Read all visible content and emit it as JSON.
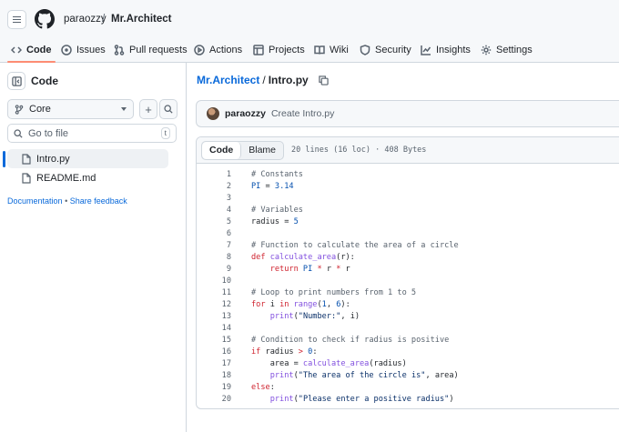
{
  "header": {
    "owner": "paraozzy",
    "separator": "/",
    "repo": "Mr.Architect"
  },
  "tabs": [
    {
      "label": "Code",
      "icon": "code-icon",
      "active": true
    },
    {
      "label": "Issues",
      "icon": "issue-opened-icon"
    },
    {
      "label": "Pull requests",
      "icon": "git-pull-request-icon"
    },
    {
      "label": "Actions",
      "icon": "play-icon"
    },
    {
      "label": "Projects",
      "icon": "table-icon"
    },
    {
      "label": "Wiki",
      "icon": "book-icon"
    },
    {
      "label": "Security",
      "icon": "shield-icon"
    },
    {
      "label": "Insights",
      "icon": "graph-icon"
    },
    {
      "label": "Settings",
      "icon": "gear-icon"
    }
  ],
  "sidebar": {
    "title": "Code",
    "branch": "Core",
    "search_placeholder": "Go to file",
    "search_shortcut": "t",
    "files": [
      {
        "name": "Intro.py",
        "selected": true
      },
      {
        "name": "README.md",
        "selected": false
      }
    ],
    "documentation": "Documentation",
    "link_sep": "•",
    "feedback": "Share feedback"
  },
  "breadcrumb": {
    "repo": "Mr.Architect",
    "sep": "/",
    "file": "Intro.py"
  },
  "commit": {
    "user": "paraozzy",
    "message": "Create Intro.py"
  },
  "code_view": {
    "tab_code": "Code",
    "tab_blame": "Blame",
    "meta": "20 lines (16 loc) · 408 Bytes"
  },
  "colors": {
    "accent": "#0969da",
    "tab_underline": "#fd8c73",
    "keyword": "#cf222e",
    "function": "#8250df",
    "number": "#0550ae",
    "string": "#0a3069",
    "comment": "#59636e"
  },
  "code_lines": [
    [
      [
        "cm",
        "# Constants"
      ]
    ],
    [
      [
        "cn",
        "PI"
      ],
      [
        "",
        " = "
      ],
      [
        "nu",
        "3.14"
      ]
    ],
    [],
    [
      [
        "cm",
        "# Variables"
      ]
    ],
    [
      [
        "",
        "radius = "
      ],
      [
        "nu",
        "5"
      ]
    ],
    [],
    [
      [
        "cm",
        "# Function to calculate the area of a circle"
      ]
    ],
    [
      [
        "kw",
        "def "
      ],
      [
        "fn",
        "calculate_area"
      ],
      [
        "",
        "(r):"
      ]
    ],
    [
      [
        "",
        "    "
      ],
      [
        "kw",
        "return "
      ],
      [
        "cn",
        "PI"
      ],
      [
        "",
        " "
      ],
      [
        "kw",
        "*"
      ],
      [
        "",
        " r "
      ],
      [
        "kw",
        "*"
      ],
      [
        "",
        " r"
      ]
    ],
    [],
    [
      [
        "cm",
        "# Loop to print numbers from 1 to 5"
      ]
    ],
    [
      [
        "kw",
        "for "
      ],
      [
        "",
        "i "
      ],
      [
        "kw",
        "in "
      ],
      [
        "fn",
        "range"
      ],
      [
        "",
        "("
      ],
      [
        "nu",
        "1"
      ],
      [
        "",
        ", "
      ],
      [
        "nu",
        "6"
      ],
      [
        "",
        "):"
      ]
    ],
    [
      [
        "",
        "    "
      ],
      [
        "fn",
        "print"
      ],
      [
        "",
        "("
      ],
      [
        "st",
        "\"Number:\""
      ],
      [
        "",
        ", i)"
      ]
    ],
    [],
    [
      [
        "cm",
        "# Condition to check if radius is positive"
      ]
    ],
    [
      [
        "kw",
        "if "
      ],
      [
        "",
        "radius "
      ],
      [
        "kw",
        ">"
      ],
      [
        "",
        " "
      ],
      [
        "nu",
        "0"
      ],
      [
        "",
        ":"
      ]
    ],
    [
      [
        "",
        "    area = "
      ],
      [
        "fn",
        "calculate_area"
      ],
      [
        "",
        "(radius)"
      ]
    ],
    [
      [
        "",
        "    "
      ],
      [
        "fn",
        "print"
      ],
      [
        "",
        "("
      ],
      [
        "st",
        "\"The area of the circle is\""
      ],
      [
        "",
        ", area)"
      ]
    ],
    [
      [
        "kw",
        "else"
      ],
      [
        "",
        ":"
      ]
    ],
    [
      [
        "",
        "    "
      ],
      [
        "fn",
        "print"
      ],
      [
        "",
        "("
      ],
      [
        "st",
        "\"Please enter a positive radius\""
      ],
      [
        "",
        ")"
      ]
    ]
  ]
}
